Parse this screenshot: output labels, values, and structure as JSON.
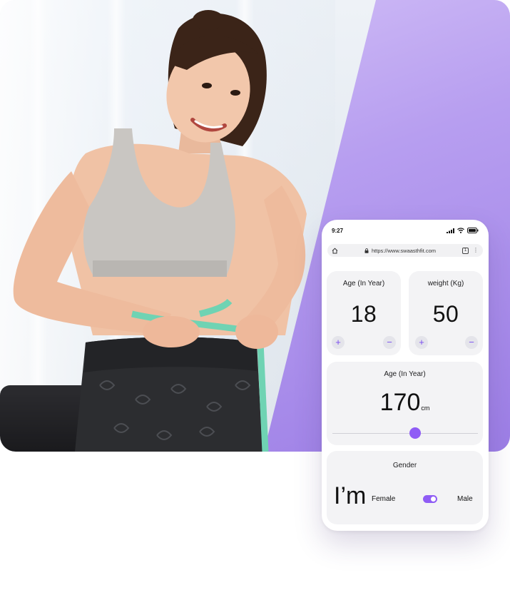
{
  "status_bar": {
    "time": "9:27"
  },
  "browser": {
    "url": "https://www.swaasthfit.com",
    "tab_count": "1"
  },
  "age_card": {
    "title": "Age (In Year)",
    "value": "18",
    "plus": "+",
    "minus": "−"
  },
  "weight_card": {
    "title": "weight (Kg)",
    "value": "50",
    "plus": "+",
    "minus": "−"
  },
  "height_card": {
    "title": "Age (In Year)",
    "value": "170",
    "unit": "cm",
    "slider_fraction": 0.57
  },
  "gender_card": {
    "title": "Gender",
    "lead": "I’m",
    "option_left": "Female",
    "option_right": "Male",
    "toggle_on": true
  },
  "colors": {
    "accent": "#8f5cf5",
    "band": "#b79ef0",
    "card_bg": "#f3f3f5"
  }
}
